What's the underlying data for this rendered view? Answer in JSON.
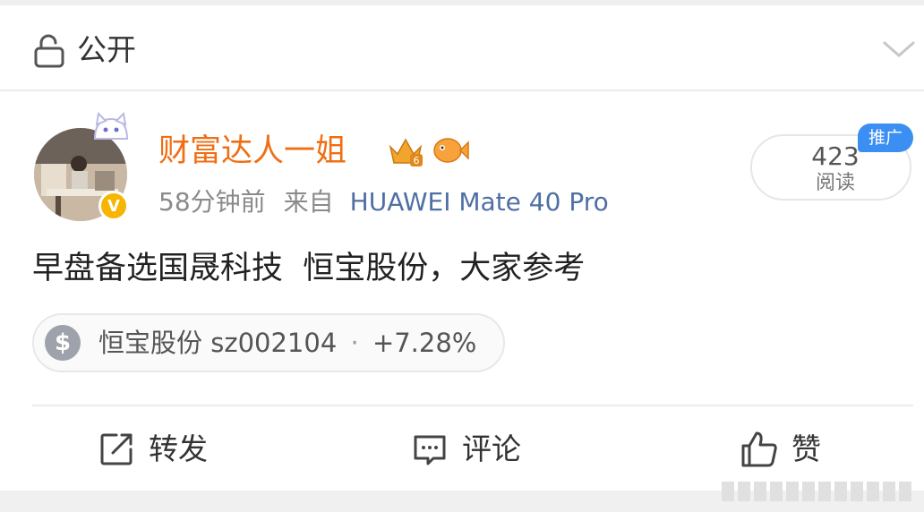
{
  "visibility": {
    "label": "公开",
    "icon": "lock-open-icon"
  },
  "author": {
    "name": "财富达人一姐",
    "verified_badge": "V",
    "badges": [
      "crown-level-icon",
      "fish-icon"
    ]
  },
  "post_meta": {
    "time": "58分钟前",
    "from_label": "来自",
    "source": "HUAWEI Mate 40 Pro"
  },
  "reads": {
    "count": "423",
    "label": "阅读"
  },
  "promo_tag": "推广",
  "content": "早盘备选国晟科技  恒宝股份，大家参考",
  "stock": {
    "symbol_icon": "$",
    "name": "恒宝股份",
    "code": "sz002104",
    "separator": "·",
    "change": "+7.28%"
  },
  "actions": {
    "repost": "转发",
    "comment": "评论",
    "like": "赞"
  },
  "colors": {
    "username": "#f06e14",
    "source": "#4f6fa3",
    "promo": "#3b8ff2",
    "verified": "#f7b500"
  }
}
